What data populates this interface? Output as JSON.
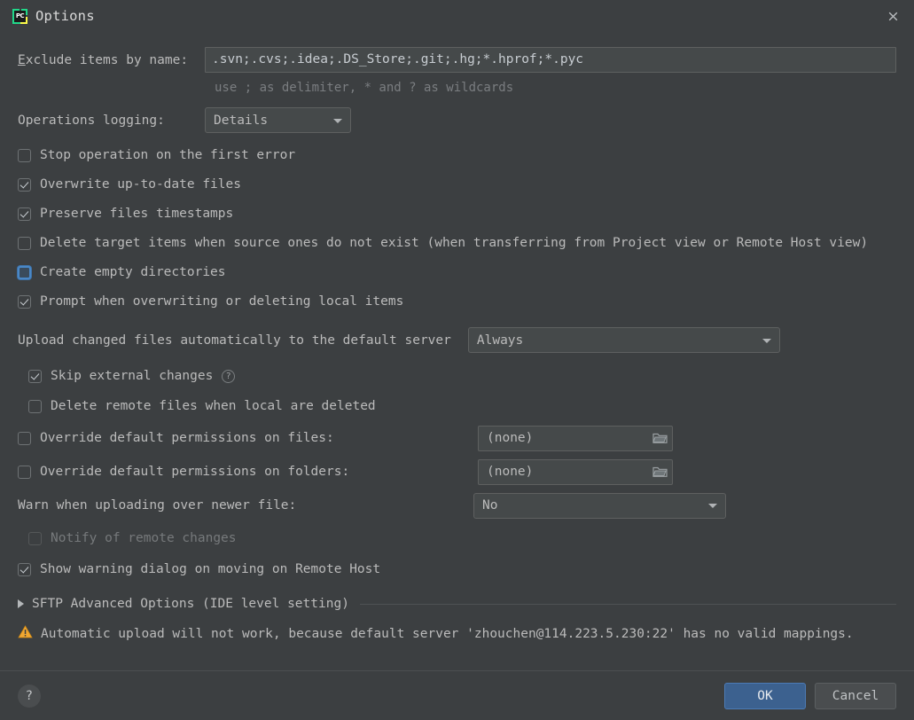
{
  "window": {
    "title": "Options",
    "app_icon": "pycharm-icon",
    "icon_text": "PC",
    "close_label": "×"
  },
  "exclude": {
    "label_mnemonic": "E",
    "label_rest": "xclude items by name:",
    "value": ".svn;.cvs;.idea;.DS_Store;.git;.hg;*.hprof;*.pyc",
    "hint": "use ; as delimiter, * and ? as wildcards"
  },
  "logging": {
    "label": "Operations logging:",
    "value": "Details",
    "options": [
      "Details"
    ]
  },
  "checkboxes": [
    {
      "label": "Stop operation on the first error",
      "checked": false,
      "focused": false,
      "disabled": false
    },
    {
      "label": "Overwrite up-to-date files",
      "checked": true,
      "focused": false,
      "disabled": false
    },
    {
      "label": "Preserve files timestamps",
      "checked": true,
      "focused": false,
      "disabled": false
    },
    {
      "label": "Delete target items when source ones do not exist (when transferring from Project view or Remote Host view)",
      "checked": false,
      "focused": false,
      "disabled": false
    },
    {
      "label": "Create empty directories",
      "checked": false,
      "focused": true,
      "disabled": false
    },
    {
      "label": "Prompt when overwriting or deleting local items",
      "checked": true,
      "focused": false,
      "disabled": false
    }
  ],
  "upload": {
    "label": "Upload changed files automatically to the default server",
    "value": "Always",
    "options": [
      "Always"
    ],
    "skip_external": {
      "label": "Skip external changes",
      "checked": true,
      "help_icon": "help-circle-icon"
    },
    "delete_remote": {
      "label": "Delete remote files when local are deleted",
      "checked": false
    }
  },
  "permissions": {
    "files": {
      "label": "Override default permissions on files:",
      "checked": false,
      "value": "(none)",
      "browse_icon": "folder-icon"
    },
    "folders": {
      "label": "Override default permissions on folders:",
      "checked": false,
      "value": "(none)",
      "browse_icon": "folder-icon"
    }
  },
  "warn_newer": {
    "label": "Warn when uploading over newer file:",
    "value": "No",
    "options": [
      "No"
    ]
  },
  "notify_remote": {
    "label": "Notify of remote changes",
    "checked": false,
    "disabled": true
  },
  "show_warning_dialog": {
    "label": "Show warning dialog on moving on Remote Host",
    "checked": true
  },
  "advanced": {
    "label": "SFTP Advanced Options (IDE level setting)",
    "expanded": false,
    "icon": "chevron-right-icon"
  },
  "warning": {
    "icon": "warning-triangle-icon",
    "text": "Automatic upload will not work, because default server 'zhouchen@114.223.5.230:22' has no valid mappings."
  },
  "footer": {
    "help": "?",
    "ok": "OK",
    "cancel": "Cancel"
  },
  "colors": {
    "background": "#3c3f41",
    "field_bg": "#45494a",
    "accent_blue": "#3c618f",
    "focus_blue": "#4a88c7",
    "warning_amber": "#f0a732",
    "text": "#bbbbbb"
  }
}
